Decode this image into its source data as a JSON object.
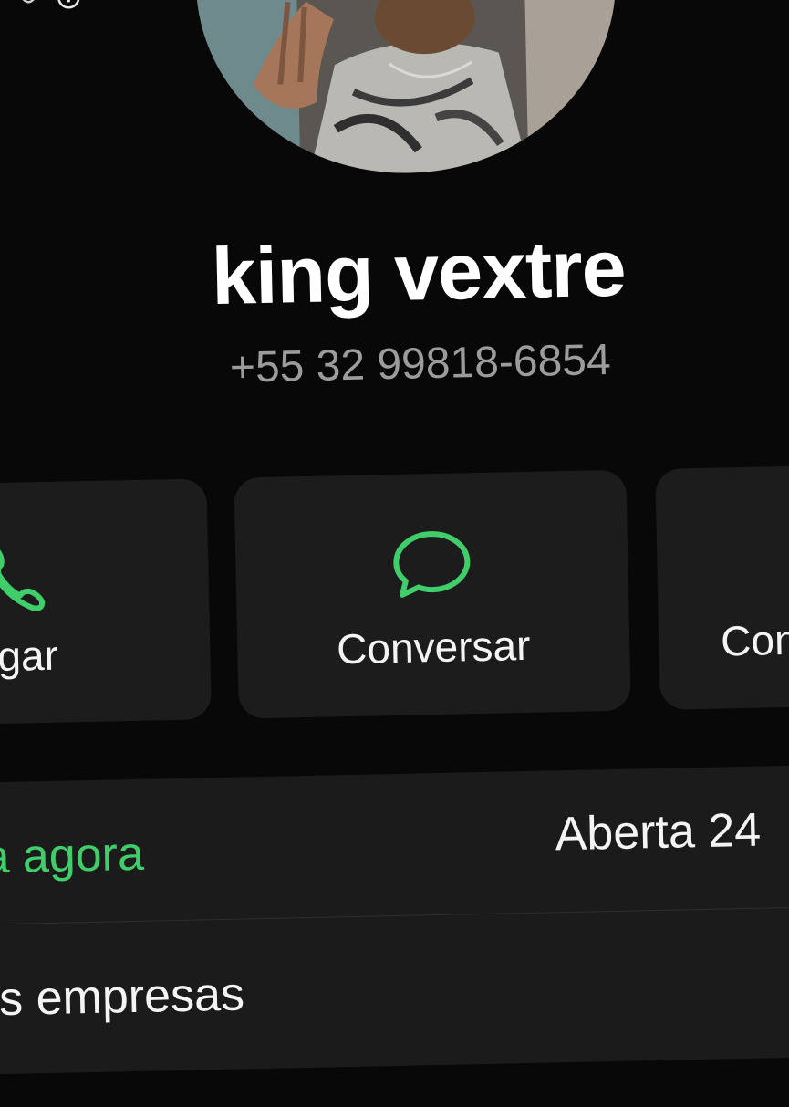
{
  "contact": {
    "name": "king vextre",
    "phone": "+55 32 99818-6854"
  },
  "actions": [
    {
      "label": "gar",
      "icon": "phone-icon"
    },
    {
      "label": "Conversar",
      "icon": "chat-bubble-icon"
    },
    {
      "label": "Con",
      "icon": "none"
    }
  ],
  "business": {
    "status": "ta agora",
    "hours": "Aberta 24",
    "category": "as empresas"
  },
  "colors": {
    "accent": "#3fce6a",
    "background": "#080808",
    "card": "#1c1c1c",
    "secondary_text": "#9c9c9c"
  }
}
